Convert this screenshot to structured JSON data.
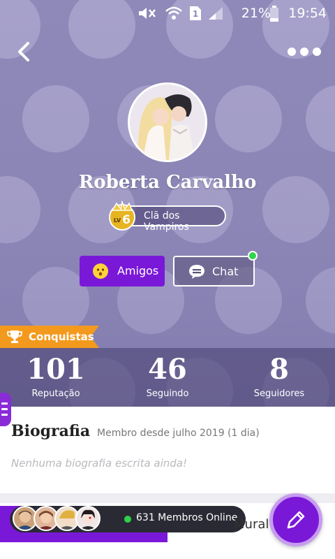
{
  "status_bar": {
    "battery_percent": "21%",
    "time": "19:54",
    "icons": [
      "mute-icon",
      "wifi-icon",
      "sim-icon",
      "signal-icon",
      "battery-icon"
    ]
  },
  "header": {
    "back_icon": "back-arrow-icon",
    "more_icon": "more-dots-icon"
  },
  "profile": {
    "name": "Roberta Carvalho",
    "level_prefix": "LV",
    "level": "6",
    "clan": "Clã dos Vampiros"
  },
  "actions": {
    "friends_label": "Amigos",
    "chat_label": "Chat"
  },
  "achievements": {
    "label": "Conquistas"
  },
  "stats": [
    {
      "value": "101",
      "label": "Reputação"
    },
    {
      "value": "46",
      "label": "Seguindo"
    },
    {
      "value": "8",
      "label": "Seguidores"
    }
  ],
  "biography": {
    "title": "Biografia",
    "member_since": "Membro desde julho 2019 (1 dia)",
    "empty_text": "Nenhuma biografia escrita ainda!"
  },
  "bottom_bar": {
    "online_members": "631 Membros Online",
    "mural_label": "Mural"
  },
  "colors": {
    "header_bg": "#8b86b4",
    "accent_purple": "#7a18d8",
    "online_green": "#31d44a",
    "ribbon_orange": "#f39a1e",
    "level_gold": "#e7b422"
  }
}
